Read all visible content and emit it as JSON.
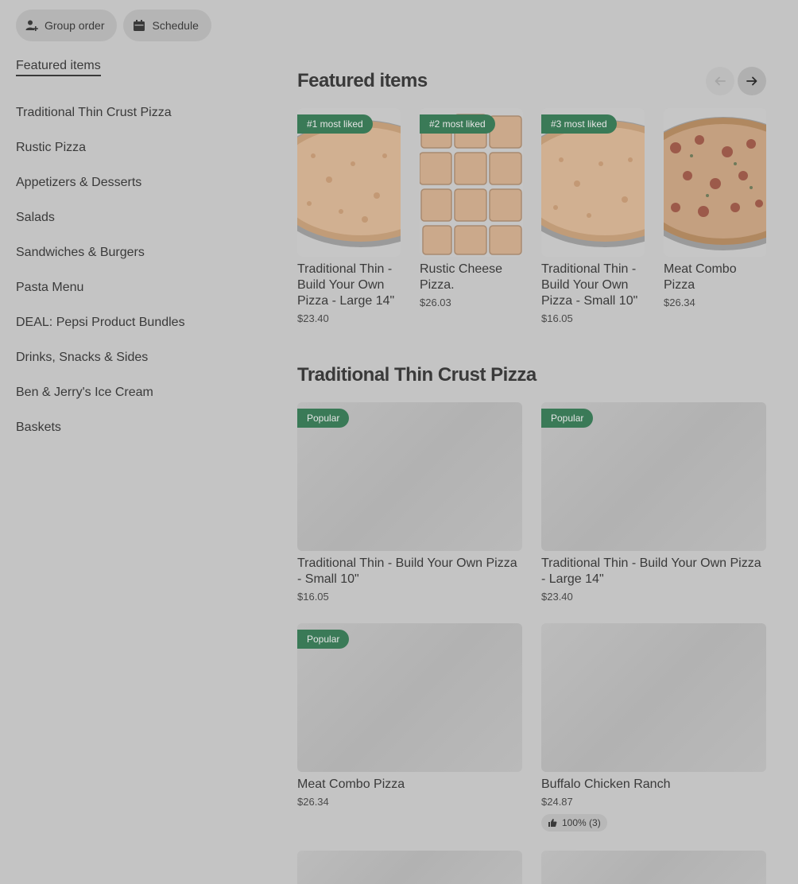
{
  "actions": {
    "group_order": "Group order",
    "schedule": "Schedule"
  },
  "nav": {
    "items": [
      {
        "label": "Featured items"
      },
      {
        "label": "Traditional Thin Crust Pizza"
      },
      {
        "label": "Rustic Pizza"
      },
      {
        "label": "Appetizers & Desserts"
      },
      {
        "label": "Salads"
      },
      {
        "label": "Sandwiches & Burgers"
      },
      {
        "label": "Pasta Menu"
      },
      {
        "label": "DEAL: Pepsi Product Bundles"
      },
      {
        "label": "Drinks, Snacks & Sides"
      },
      {
        "label": "Ben & Jerry's Ice Cream"
      },
      {
        "label": "Baskets"
      }
    ]
  },
  "featured": {
    "title": "Featured items",
    "items": [
      {
        "badge": "#1 most liked",
        "name": "Traditional Thin - Build Your Own Pizza - Large 14\"",
        "price": "$23.40"
      },
      {
        "badge": "#2 most liked",
        "name": "Rustic Cheese Pizza.",
        "price": "$26.03"
      },
      {
        "badge": "#3 most liked",
        "name": "Traditional Thin - Build Your Own Pizza - Small 10\"",
        "price": "$16.05"
      },
      {
        "badge": "",
        "name": "Meat Combo Pizza",
        "price": "$26.34"
      }
    ]
  },
  "thin_crust": {
    "title": "Traditional Thin Crust Pizza",
    "items": [
      {
        "badge": "Popular",
        "name": "Traditional Thin - Build Your Own Pizza - Small 10\"",
        "price": "$16.05"
      },
      {
        "badge": "Popular",
        "name": "Traditional Thin - Build Your Own Pizza - Large 14\"",
        "price": "$23.40"
      },
      {
        "badge": "Popular",
        "name": "Meat Combo Pizza",
        "price": "$26.34"
      },
      {
        "badge": "",
        "name": "Buffalo Chicken Ranch",
        "price": "$24.87",
        "rating": "100% (3)"
      }
    ]
  },
  "colors": {
    "badge_green": "#3a7a57",
    "background": "#c4c4c4"
  }
}
